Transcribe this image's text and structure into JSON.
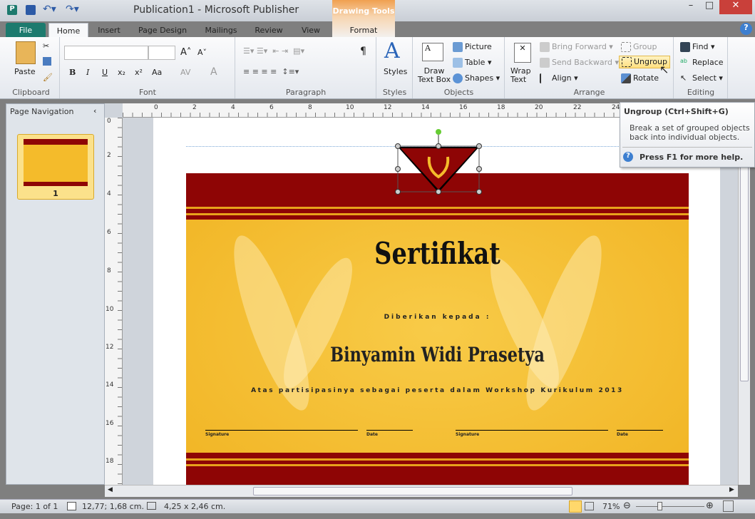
{
  "window": {
    "title": "Publication1  -  Microsoft Publisher",
    "contextual_tab": "Drawing Tools",
    "minimize": "–",
    "maximize": "□",
    "close": "✕"
  },
  "tabs": [
    "File",
    "Home",
    "Insert",
    "Page Design",
    "Mailings",
    "Review",
    "View",
    "Format"
  ],
  "ribbon": {
    "clipboard": {
      "label": "Clipboard",
      "paste": "Paste"
    },
    "font": {
      "label": "Font",
      "font_name": "",
      "font_size": "",
      "bold": "B",
      "italic": "I",
      "underline": "U",
      "subscript": "x₂",
      "superscript": "x²",
      "change_case": "Aa",
      "spacing": "AV",
      "font_color": "A",
      "grow": "A˄",
      "shrink": "A˅"
    },
    "paragraph": {
      "label": "Paragraph",
      "pilcrow": "¶"
    },
    "styles": {
      "label": "Styles",
      "button": "Styles"
    },
    "objects": {
      "label": "Objects",
      "draw_text_box": "Draw Text Box",
      "picture": "Picture",
      "table": "Table",
      "shapes": "Shapes"
    },
    "arrange": {
      "label": "Arrange",
      "wrap_text": "Wrap Text",
      "bring_forward": "Bring Forward",
      "send_backward": "Send Backward",
      "align": "Align",
      "group": "Group",
      "ungroup": "Ungroup",
      "rotate": "Rotate"
    },
    "editing": {
      "label": "Editing",
      "find": "Find",
      "replace": "Replace",
      "select": "Select"
    }
  },
  "tooltip": {
    "title": "Ungroup (Ctrl+Shift+G)",
    "body": "Break a set of grouped objects back into individual objects.",
    "help": "Press F1 for more help."
  },
  "nav": {
    "title": "Page Navigation",
    "page_number": "1"
  },
  "ruler": {
    "horizontal": [
      "0",
      "2",
      "4",
      "6",
      "8",
      "10",
      "12",
      "14",
      "16",
      "18",
      "20",
      "22",
      "24"
    ],
    "vertical": [
      "0",
      "2",
      "4",
      "6",
      "8",
      "10",
      "12",
      "14",
      "16",
      "18"
    ]
  },
  "certificate": {
    "title": "Sertifikat",
    "given_to": "Diberikan kepada :",
    "name": "Binyamin Widi  Prasetya",
    "description": "Atas partisipasinya sebagai peserta dalam Workshop Kurikulum 2013",
    "signature_label": "Signature",
    "date_label": "Date",
    "colors": {
      "band": "#8e0505",
      "gold": "#f4bb2b"
    }
  },
  "status": {
    "page": "Page: 1 of 1",
    "position": "12,77; 1,68 cm.",
    "size": "4,25 x  2,46 cm.",
    "zoom": "71%"
  }
}
